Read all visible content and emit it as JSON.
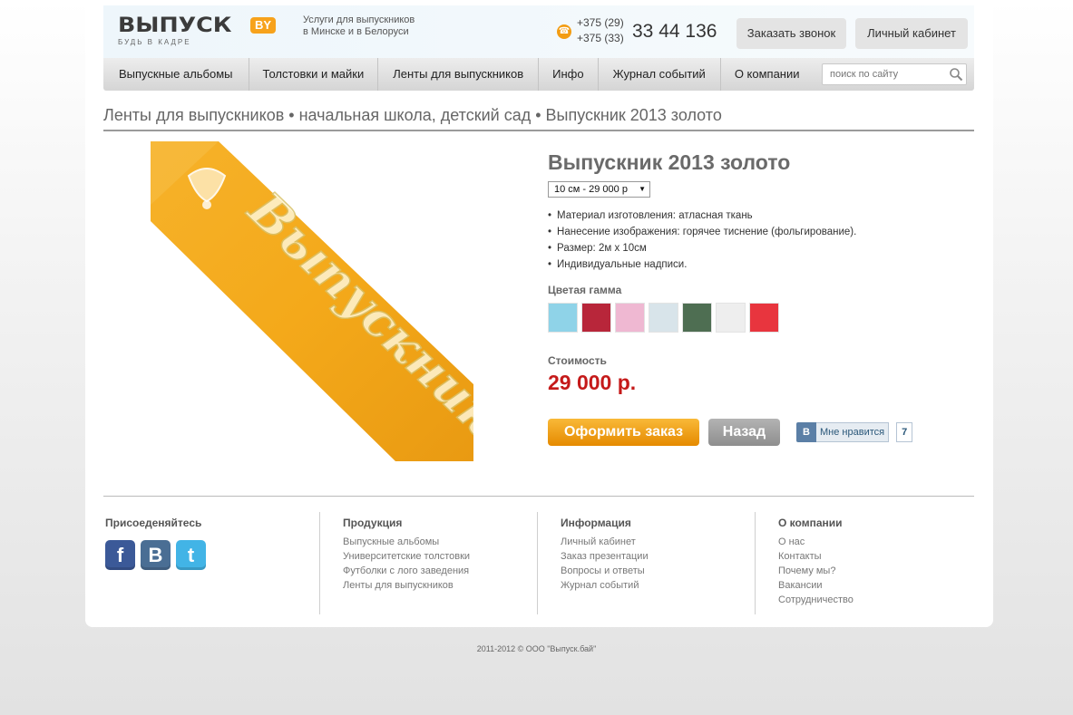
{
  "header": {
    "logo_text": "ВЫПУСК",
    "logo_badge": "BY",
    "logo_tagline": "БУДЬ В КАДРЕ",
    "services_line1": "Услуги для выпускников",
    "services_line2": "в Минске и в Белоруси",
    "phone_code1": "+375 (29)",
    "phone_code2": "+375 (33)",
    "phone_number": "33 44 136",
    "callback_label": "Заказать звонок",
    "cabinet_label": "Личный кабинет"
  },
  "nav": {
    "items": [
      {
        "label": "Выпускные альбомы"
      },
      {
        "label": "Толстовки и майки"
      },
      {
        "label": "Ленты для выпускников"
      },
      {
        "label": "Инфо"
      },
      {
        "label": "Журнал событий"
      },
      {
        "label": "О компании"
      }
    ],
    "search_placeholder": "поиск по сайту"
  },
  "breadcrumb": {
    "part1": "Ленты для выпускников",
    "sep": " • ",
    "part2": "начальная школа, детский сад",
    "part3": "Выпускник 2013 золото"
  },
  "product": {
    "image_text": "Выпускник",
    "title": "Выпускник 2013 золото",
    "size_option": "10 см - 29 000 р",
    "features": [
      "Материал изготовления: атласная ткань",
      "Нанесение изображения: горячее тиснение (фольгирование).",
      "Размер: 2м х 10см",
      "Индивидуальные надписи."
    ],
    "palette_label": "Цветая гамма",
    "swatches": [
      "#8fd3e8",
      "#b8263a",
      "#efb8d2",
      "#d8e4ea",
      "#4e6e52",
      "#eeeeee",
      "#e8353e"
    ],
    "price_label": "Стоимость",
    "price": "29 000 р.",
    "order_label": "Оформить заказ",
    "back_label": "Назад",
    "vk_letter": "В",
    "vk_like_label": "Мне нравится",
    "vk_like_count": "7"
  },
  "footer": {
    "join_title": "Присоеденяйтесь",
    "social": [
      {
        "name": "facebook-icon",
        "glyph": "f",
        "color": "#3b5998"
      },
      {
        "name": "vkontakte-icon",
        "glyph": "B",
        "color": "#4a6e94"
      },
      {
        "name": "twitter-icon",
        "glyph": "t",
        "color": "#42b4e6"
      }
    ],
    "products_title": "Продукция",
    "products": [
      "Выпускные альбомы",
      "Университетские толстовки",
      "Футболки с лого заведения",
      "Ленты для выпускников"
    ],
    "info_title": "Информация",
    "info": [
      "Личный кабинет",
      "Заказ презентации",
      "Вопросы и ответы",
      "Журнал событий"
    ],
    "company_title": "О компании",
    "company": [
      "О нас",
      "Контакты",
      "Почему мы?",
      "Вакансии",
      "Сотрудничество"
    ],
    "copyright": "2011-2012  ©  ООО \"Выпуск.бай\""
  }
}
